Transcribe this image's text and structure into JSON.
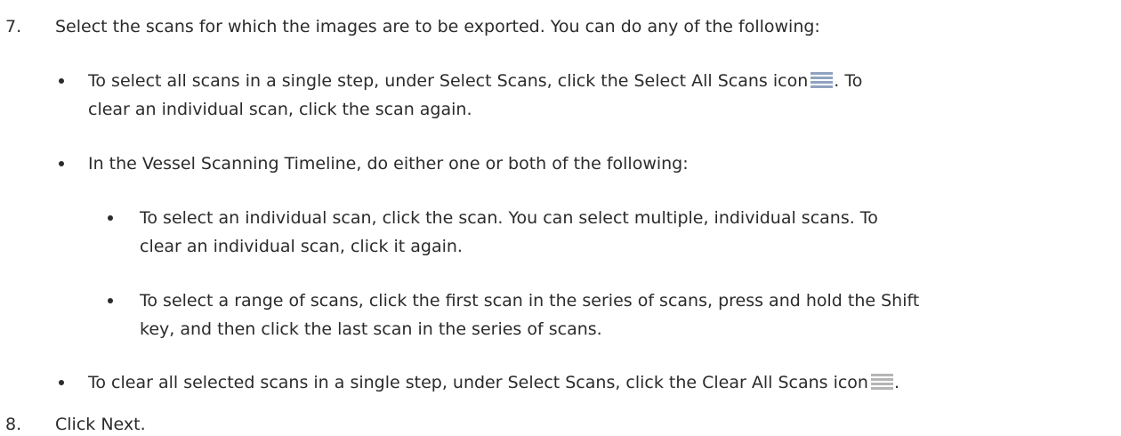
{
  "step7": {
    "number": "7.",
    "text": "Select the scans for which the images are to be exported. You can do any of the following:"
  },
  "bullet_select_all": {
    "text_before_icon": "To select all scans in a single step, under Select Scans, click the Select All Scans icon",
    "text_after_icon": ". To",
    "line2": "clear an individual scan, click the scan again.",
    "icon": "select-all-scans-icon",
    "icon_color": "#8fa3bf"
  },
  "bullet_timeline": {
    "text": "In the Vessel Scanning Timeline, do either one or both of the following:"
  },
  "sub_individual": {
    "line1": "To select an individual scan, click the scan. You can select multiple, individual scans. To",
    "line2": "clear an individual scan, click it again."
  },
  "sub_range": {
    "line1": "To select a range of scans, click the first scan in the series of scans, press and hold the Shift",
    "line2": "key, and then click the last scan in the series of scans."
  },
  "bullet_clear_all": {
    "text_before_icon": "To clear all selected scans in a single step, under Select Scans, click the Clear All Scans icon",
    "text_after_icon": ".",
    "icon": "clear-all-scans-icon",
    "icon_color": "#b5b5b5"
  },
  "step8": {
    "number": "8.",
    "text": "Click Next."
  }
}
